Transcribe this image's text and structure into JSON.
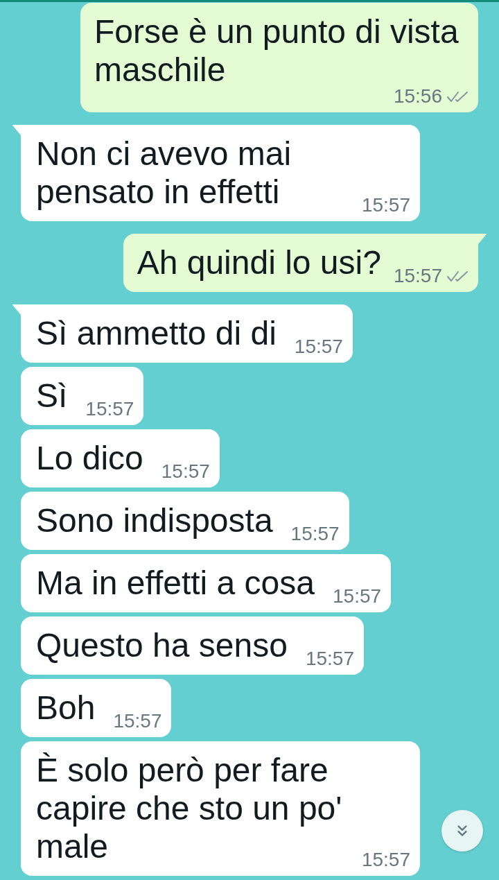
{
  "messages": [
    {
      "kind": "outgoing",
      "tail": false,
      "text": "Forse è un punto di vista maschile",
      "time": "15:56",
      "delivered": true,
      "read": false
    },
    {
      "kind": "incoming",
      "tail": true,
      "text": "Non ci avevo mai pensato in effetti",
      "time": "15:57"
    },
    {
      "kind": "outgoing",
      "tail": true,
      "text": "Ah quindi lo usi?",
      "time": "15:57",
      "delivered": true,
      "read": false
    },
    {
      "kind": "incoming",
      "tail": true,
      "text": "Sì ammetto di di",
      "time": "15:57"
    },
    {
      "kind": "incoming",
      "tail": false,
      "text": "Sì",
      "time": "15:57"
    },
    {
      "kind": "incoming",
      "tail": false,
      "text": "Lo dico",
      "time": "15:57"
    },
    {
      "kind": "incoming",
      "tail": false,
      "text": "Sono indisposta",
      "time": "15:57"
    },
    {
      "kind": "incoming",
      "tail": false,
      "text": "Ma in effetti a cosa",
      "time": "15:57"
    },
    {
      "kind": "incoming",
      "tail": false,
      "text": "Questo ha senso",
      "time": "15:57"
    },
    {
      "kind": "incoming",
      "tail": false,
      "text": "Boh",
      "time": "15:57"
    },
    {
      "kind": "incoming",
      "tail": false,
      "text": "È solo però per fare capire che sto un po' male",
      "time": "15:57"
    }
  ]
}
